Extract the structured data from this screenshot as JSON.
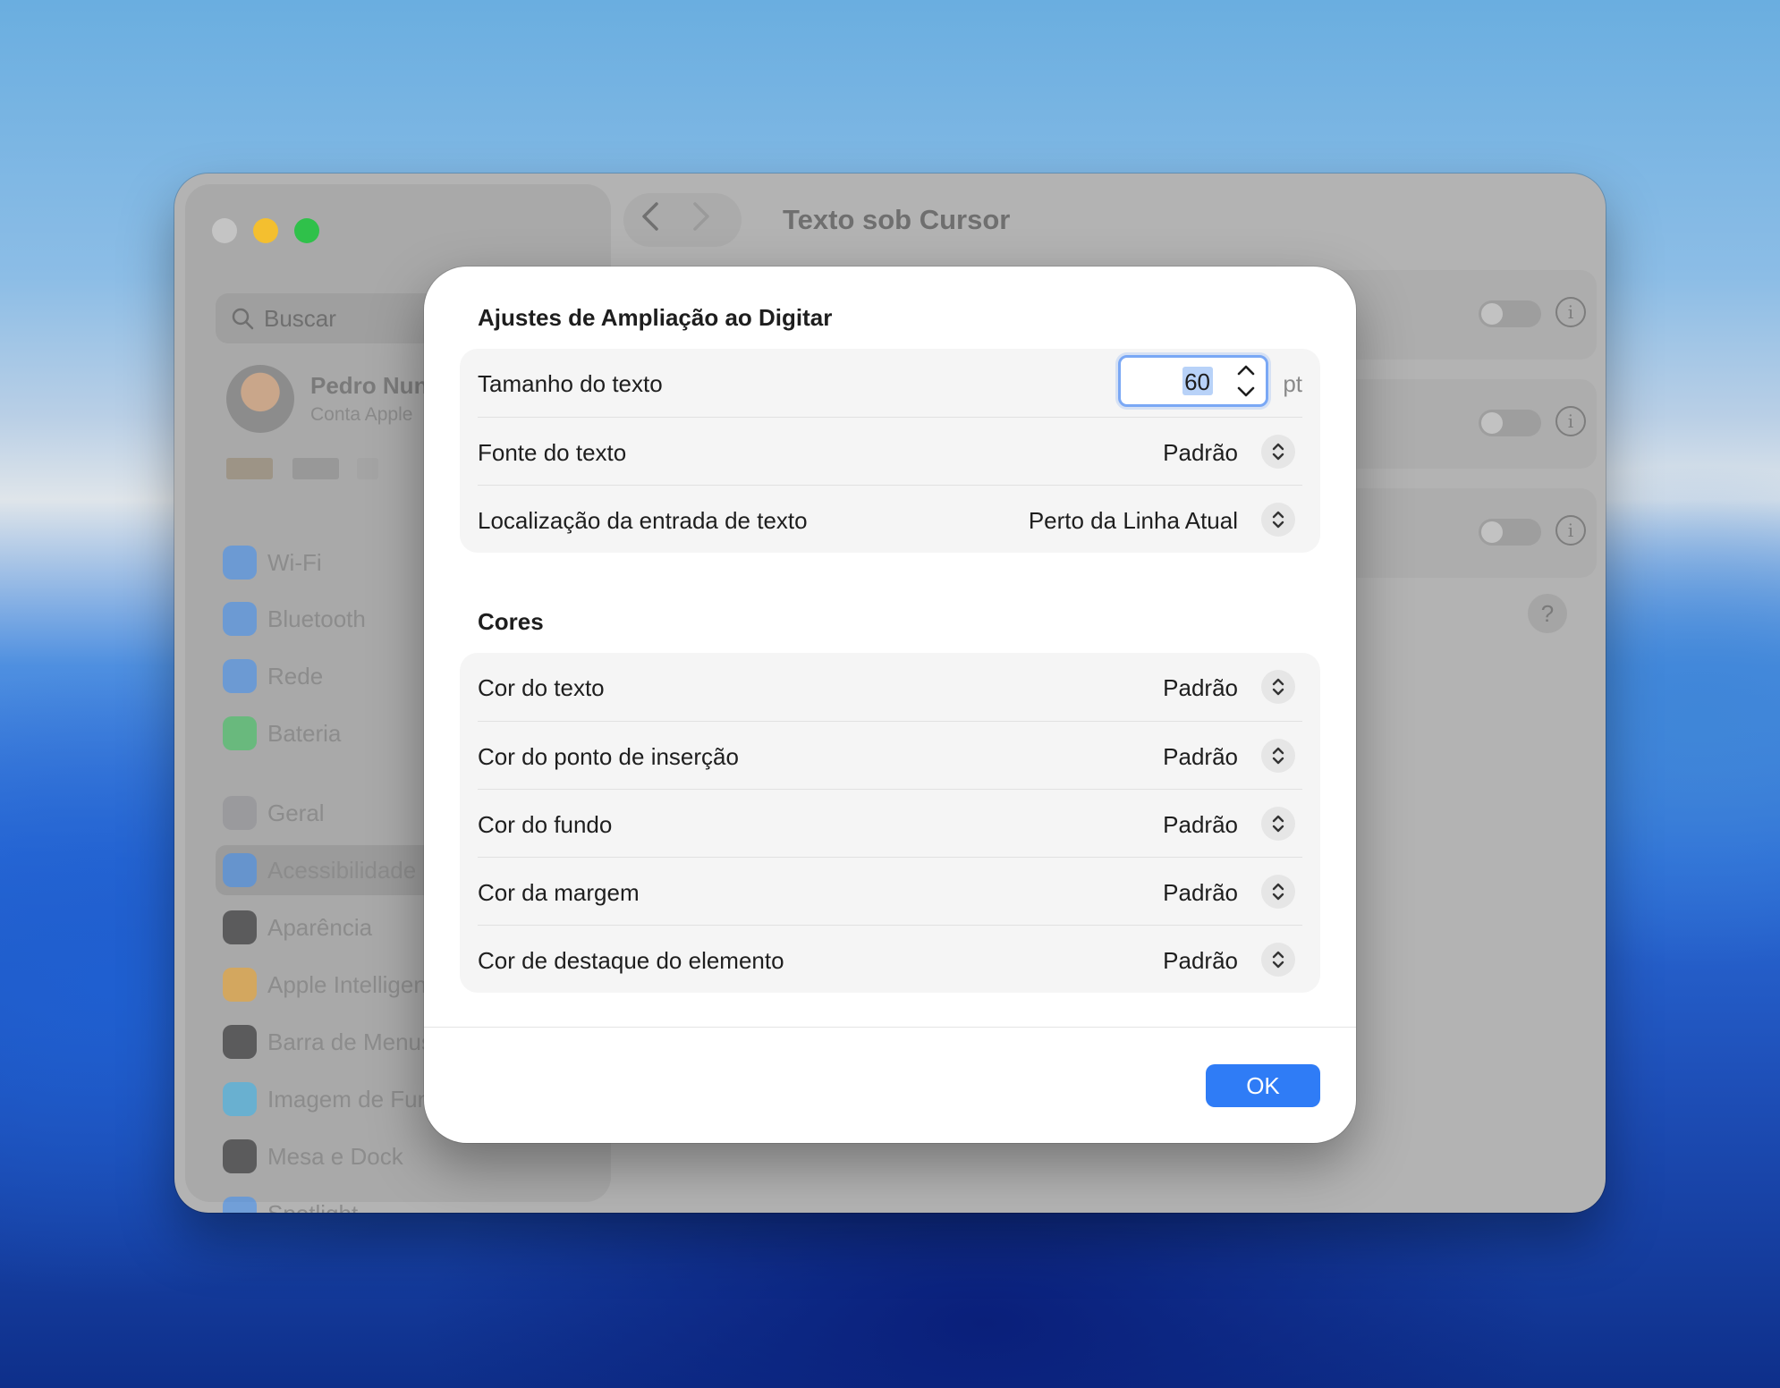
{
  "window": {
    "title": "Texto sob Cursor"
  },
  "sidebar": {
    "search_placeholder": "Buscar",
    "profile": {
      "name": "Pedro Nunes",
      "subtitle": "Conta Apple"
    },
    "items": [
      {
        "label": "Wi-Fi",
        "icon": "wifi-icon",
        "color": "#3a8ef6"
      },
      {
        "label": "Bluetooth",
        "icon": "bluetooth-icon",
        "color": "#3a8ef6"
      },
      {
        "label": "Rede",
        "icon": "globe-icon",
        "color": "#3a8ef6"
      },
      {
        "label": "Bateria",
        "icon": "battery-icon",
        "color": "#34c759"
      },
      {
        "label": "Geral",
        "icon": "gear-icon",
        "color": "#8e8e93"
      },
      {
        "label": "Acessibilidade",
        "icon": "accessibility-icon",
        "color": "#3a8ef6"
      },
      {
        "label": "Aparência",
        "icon": "appearance-icon",
        "color": "#1c1c1e"
      },
      {
        "label": "Apple Intelligence",
        "icon": "apple-intelligence-icon",
        "color": "#f5a623"
      },
      {
        "label": "Barra de Menus",
        "icon": "menubar-icon",
        "color": "#1c1c1e"
      },
      {
        "label": "Imagem de Fundo",
        "icon": "wallpaper-icon",
        "color": "#35b6f0"
      },
      {
        "label": "Mesa e Dock",
        "icon": "dock-icon",
        "color": "#1c1c1e"
      },
      {
        "label": "Spotlight",
        "icon": "spotlight-icon",
        "color": "#3a8ef6"
      }
    ]
  },
  "dialog": {
    "section1_title": "Ajustes de Ampliação ao Digitar",
    "text_size": {
      "label": "Tamanho do texto",
      "value": "60",
      "unit": "pt"
    },
    "font": {
      "label": "Fonte do texto",
      "value": "Padrão"
    },
    "location": {
      "label": "Localização da entrada de texto",
      "value": "Perto da Linha Atual"
    },
    "section2_title": "Cores",
    "colors": [
      {
        "label": "Cor do texto",
        "value": "Padrão"
      },
      {
        "label": "Cor do ponto de inserção",
        "value": "Padrão"
      },
      {
        "label": "Cor do fundo",
        "value": "Padrão"
      },
      {
        "label": "Cor da margem",
        "value": "Padrão"
      },
      {
        "label": "Cor de destaque do elemento",
        "value": "Padrão"
      }
    ],
    "ok_label": "OK"
  },
  "background_panel": {
    "help_label": "?"
  },
  "accent_color": "#2f7cf6"
}
